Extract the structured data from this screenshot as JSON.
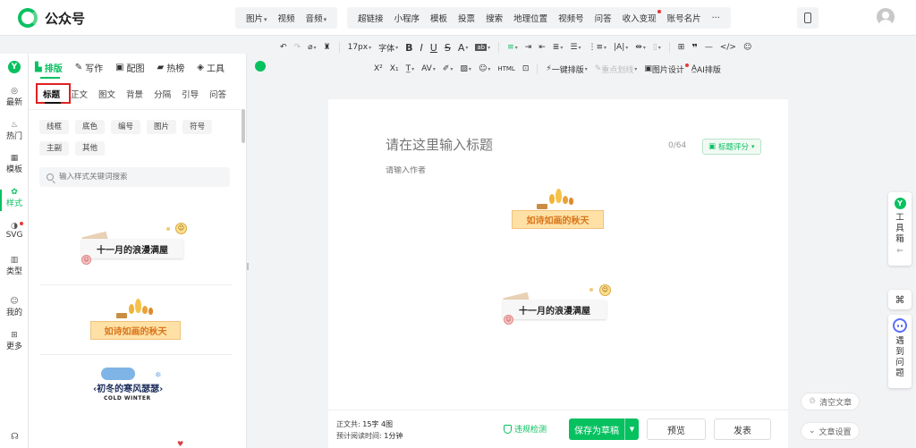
{
  "app": {
    "name": "公众号"
  },
  "topbar": {
    "insert_group_1": [
      {
        "label": "图片",
        "caret": true
      },
      {
        "label": "视频",
        "caret": false
      },
      {
        "label": "音频",
        "caret": true
      }
    ],
    "insert_group_2": [
      {
        "label": "超链接",
        "dot": false
      },
      {
        "label": "小程序",
        "dot": false
      },
      {
        "label": "模板",
        "dot": false
      },
      {
        "label": "投票",
        "dot": false
      },
      {
        "label": "搜索",
        "dot": false
      },
      {
        "label": "地理位置",
        "dot": false
      },
      {
        "label": "视频号",
        "dot": false
      },
      {
        "label": "问答",
        "dot": false
      },
      {
        "label": "收入变现",
        "dot": true
      },
      {
        "label": "账号名片",
        "dot": false
      },
      {
        "label": "···",
        "dot": false
      }
    ]
  },
  "toolbar": {
    "font_size": "17px",
    "font_label": "字体",
    "one_click_layout": "一键排版",
    "key_underline": "重点划线",
    "image_design": "图片设计",
    "ai_layout": "AI排版"
  },
  "rail": [
    {
      "icon": "◎",
      "label": "最新",
      "name": "rail-latest"
    },
    {
      "icon": "♨",
      "label": "热门",
      "name": "rail-hot"
    },
    {
      "icon": "▦",
      "label": "模板",
      "name": "rail-template"
    },
    {
      "icon": "✿",
      "label": "样式",
      "name": "rail-style",
      "active": true
    },
    {
      "icon": "◑",
      "label": "SVG",
      "name": "rail-svg",
      "dot": true
    },
    {
      "icon": "▥",
      "label": "类型",
      "name": "rail-type"
    },
    {
      "icon": "☺",
      "label": "我的",
      "name": "rail-mine"
    },
    {
      "icon": "⊞",
      "label": "更多",
      "name": "rail-more"
    }
  ],
  "panel": {
    "tabs": [
      {
        "label": "排版",
        "icon": "▙",
        "active": true
      },
      {
        "label": "写作",
        "icon": "✎"
      },
      {
        "label": "配图",
        "icon": "▣"
      },
      {
        "label": "热榜",
        "icon": "▰"
      },
      {
        "label": "工具",
        "icon": "◈"
      }
    ],
    "subtabs": [
      "标题",
      "正文",
      "图文",
      "背景",
      "分隔",
      "引导",
      "问答"
    ],
    "chips_row1": [
      "线框",
      "底色",
      "编号",
      "图片",
      "符号"
    ],
    "chips_row2": [
      "主副",
      "其他"
    ],
    "search_placeholder": "输入样式关键词搜索",
    "samples": {
      "sample1_title": "十一月的浪漫满屋",
      "sample2_title": "如诗如画的秋天",
      "sample3_title": "初冬的寒风瑟瑟",
      "sample3_sub": "COLD WINTER"
    }
  },
  "editor": {
    "title_placeholder": "请在这里输入标题",
    "title_count": "0/64",
    "score_label": "标题评分",
    "author_placeholder": "请输入作者",
    "block1_title": "如诗如画的秋天",
    "block2_title": "十一月的浪漫满屋"
  },
  "bottom": {
    "stats_label1": "正文共:",
    "stats_value1": "15字 4图",
    "stats_label2": "预计阅读时间:",
    "stats_value2": "1分钟",
    "check_label": "违规检测",
    "save_label": "保存为草稿",
    "preview_label": "预览",
    "publish_label": "发表"
  },
  "right": {
    "toolbox_label": "工具箱",
    "issue_label": "遇到问题",
    "clear_label": "清空文章",
    "settings_label": "文章设置"
  }
}
